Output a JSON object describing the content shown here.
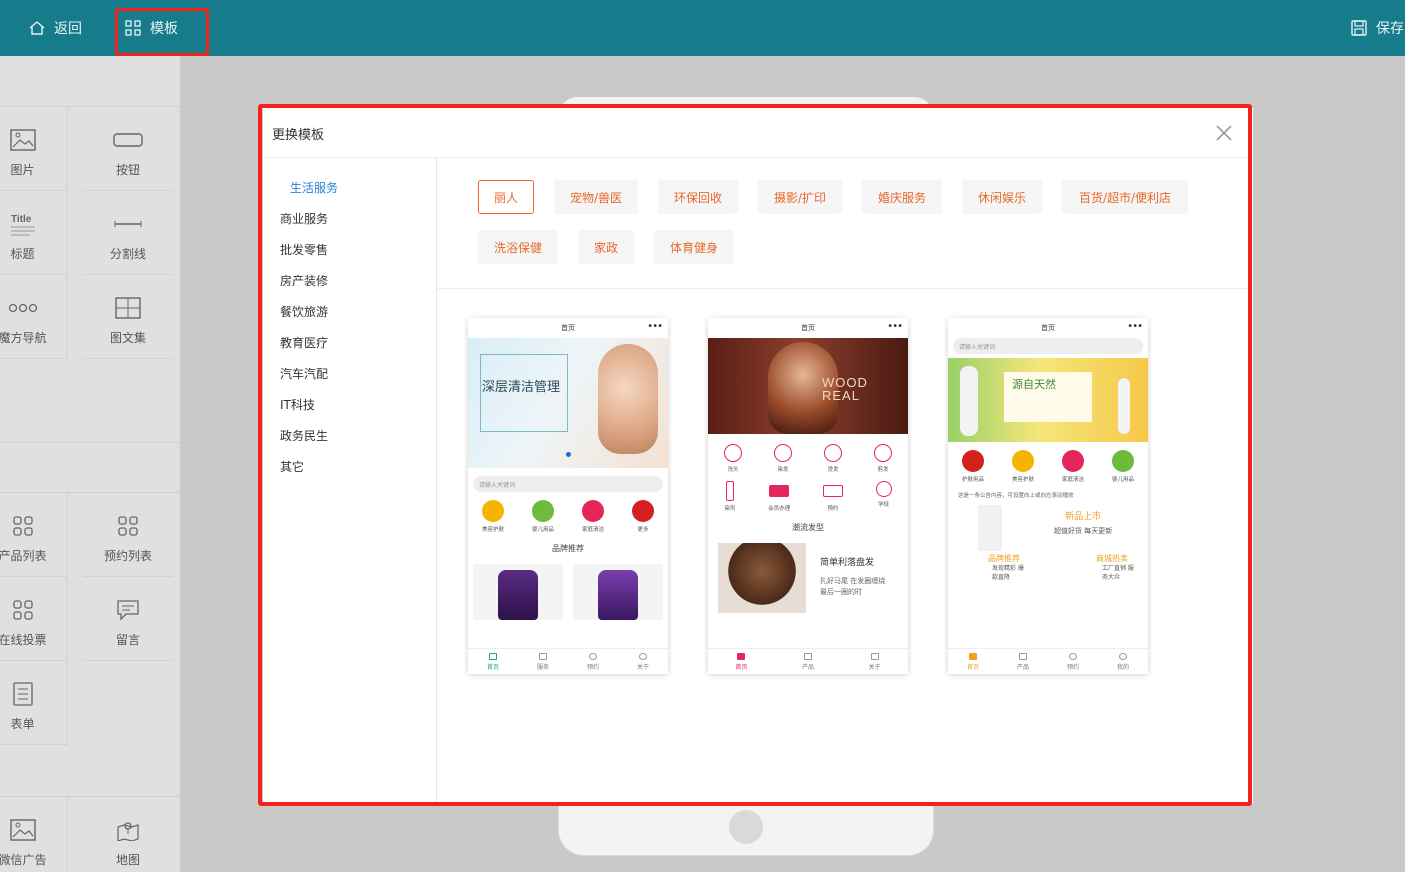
{
  "topbar": {
    "back_label": "返回",
    "template_label": "模板",
    "save_label": "保存"
  },
  "sidebar": {
    "items": [
      {
        "label": "图片",
        "icon": "image-icon"
      },
      {
        "label": "按钮",
        "icon": "button-icon"
      },
      {
        "label": "标题",
        "icon": "title-icon"
      },
      {
        "label": "分割线",
        "icon": "divider-icon"
      },
      {
        "label": "魔方导航",
        "icon": "cube-nav-icon"
      },
      {
        "label": "图文集",
        "icon": "grid-image-icon"
      },
      {
        "label": "产品列表",
        "icon": "product-list-icon"
      },
      {
        "label": "预约列表",
        "icon": "booking-list-icon"
      },
      {
        "label": "在线投票",
        "icon": "vote-icon"
      },
      {
        "label": "留言",
        "icon": "message-icon"
      },
      {
        "label": "表单",
        "icon": "form-icon"
      },
      {
        "label": "微信广告",
        "icon": "wechat-ad-icon"
      },
      {
        "label": "地图",
        "icon": "map-icon"
      }
    ]
  },
  "modal": {
    "title": "更换模板",
    "categories": [
      "生活服务",
      "商业服务",
      "批发零售",
      "房产装修",
      "餐饮旅游",
      "教育医疗",
      "汽车汽配",
      "IT科技",
      "政务民生",
      "其它"
    ],
    "active_category": "生活服务",
    "tags": [
      "丽人",
      "宠物/兽医",
      "环保回收",
      "摄影/扩印",
      "婚庆服务",
      "休闲娱乐",
      "百货/超市/便利店",
      "洗浴保健",
      "家政",
      "体育健身"
    ],
    "selected_tag": "丽人",
    "templates": [
      {
        "page_title": "首页",
        "banner_title": "深层清洁管理",
        "search_placeholder": "请输入关键词",
        "icons": [
          "美容护肤",
          "婴儿用品",
          "家庭清洁",
          "更多"
        ],
        "section_title": "品牌推荐",
        "tabs": [
          "首页",
          "服务",
          "预约",
          "关于"
        ]
      },
      {
        "page_title": "首页",
        "banner_text": "WOOD REAL",
        "icons_row1": [
          "洗头",
          "染发",
          "烫发",
          "剪发"
        ],
        "icons_row2": [
          "染剂",
          "会员办理",
          "预约",
          "学徒"
        ],
        "section_title": "潮流发型",
        "article_title": "简单利落盘发",
        "article_desc": "扎好马尾 在发圈缠绕最后一圈的时",
        "tabs": [
          "首页",
          "产品",
          "关于"
        ]
      },
      {
        "page_title": "首页",
        "search_placeholder": "请输入关键词",
        "banner_title": "源自天然",
        "icons": [
          "护肤用品",
          "美容护肤",
          "家庭清洁",
          "婴儿用品"
        ],
        "notice": "这是一条公告内容，可设置向上或向左滚动播放",
        "new_title": "新品上市",
        "new_sub": "超值好货 每天更新",
        "brand_title": "品牌推荐",
        "brand_sub": "发现精彩 爆款直降",
        "hot_title": "商城热卖",
        "hot_sub": "工厂直销 服务大众",
        "tabs": [
          "首页",
          "产品",
          "预约",
          "我的"
        ]
      }
    ]
  },
  "colors": {
    "topbar": "#167c8c",
    "highlight_border": "#f2231d",
    "tag_text": "#e8682a",
    "active_category": "#2a83d4"
  }
}
